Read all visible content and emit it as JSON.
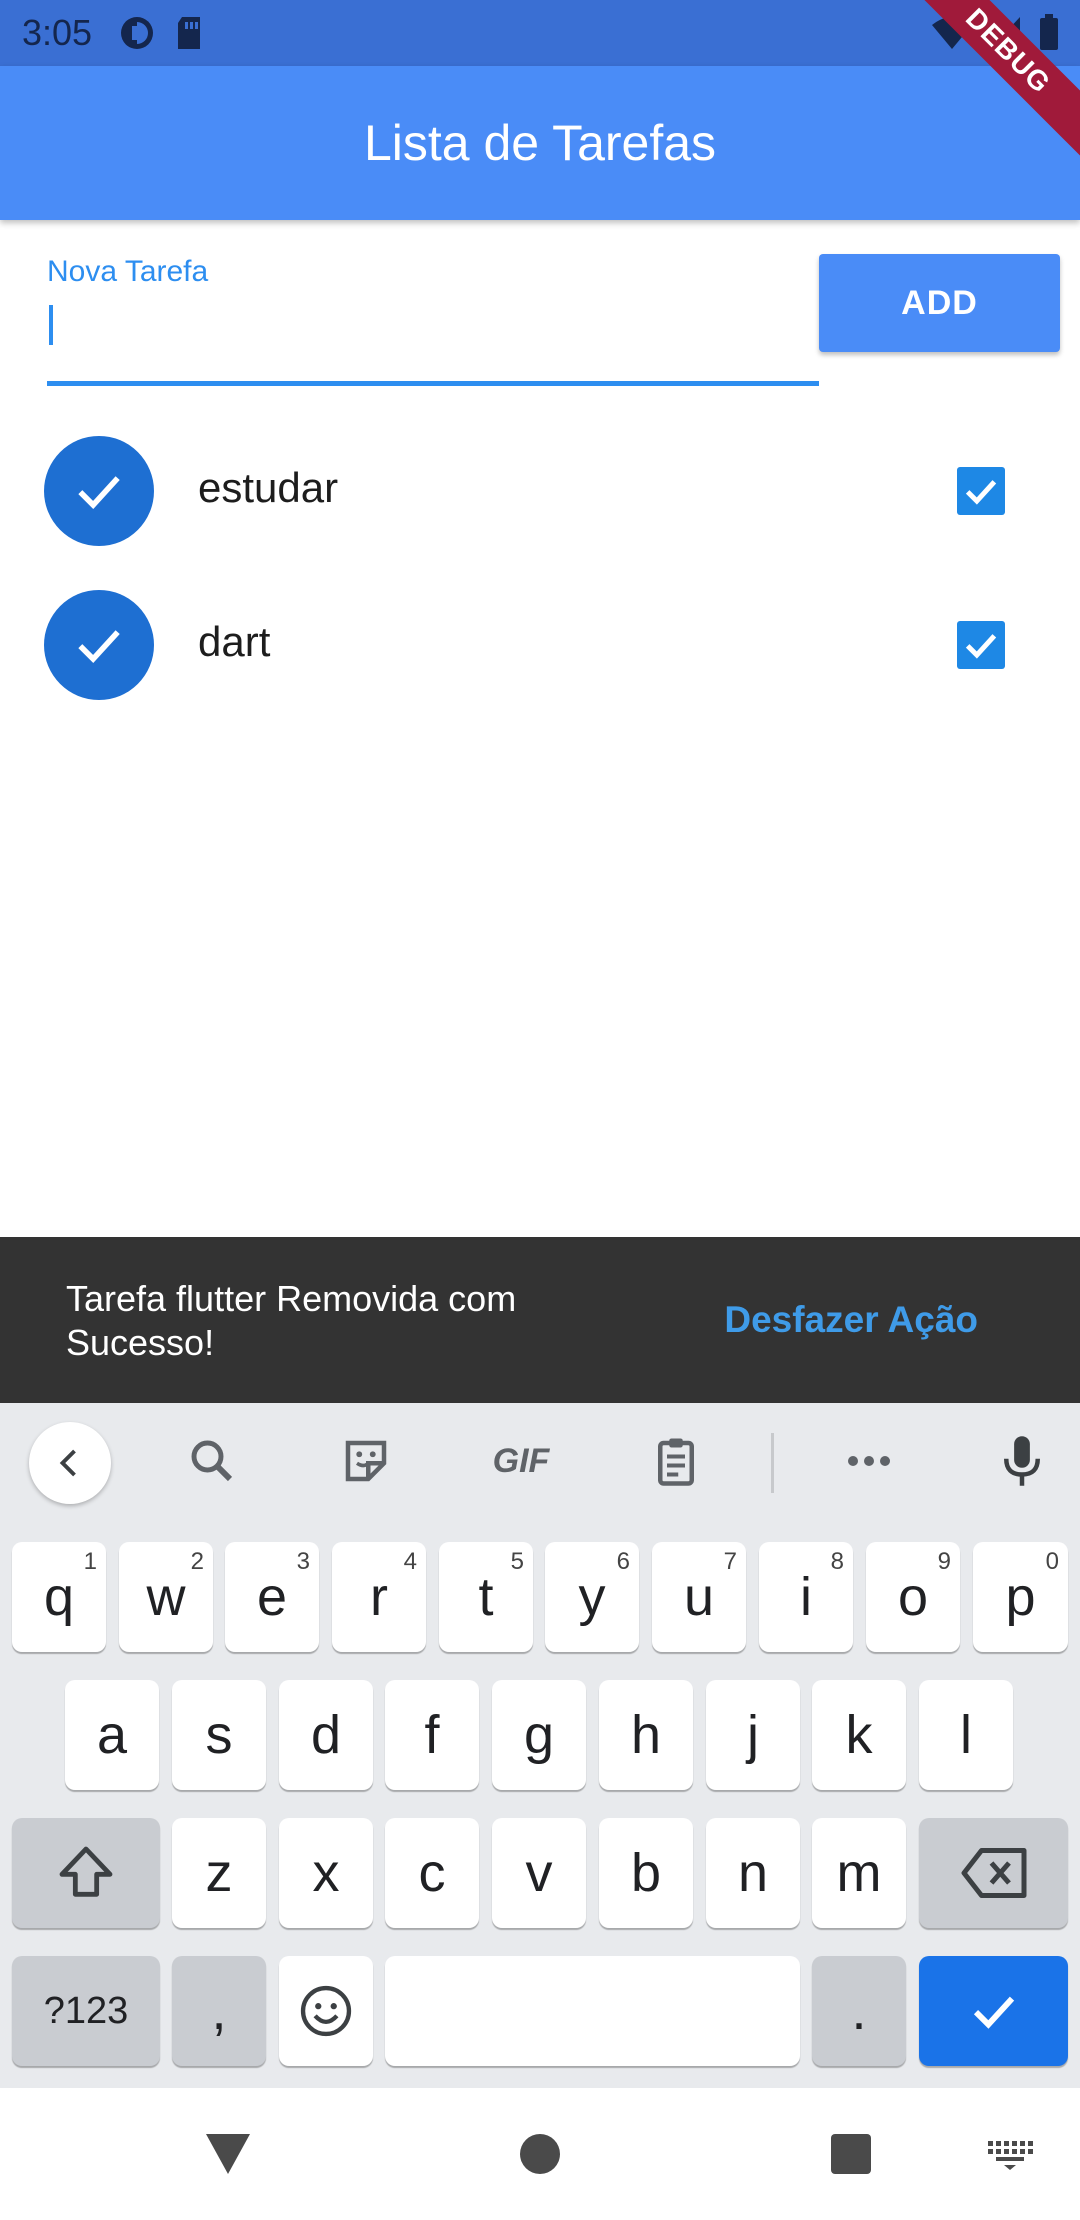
{
  "status_bar": {
    "time": "3:05",
    "icons_left": [
      "data-saver-icon",
      "sd-card-icon"
    ],
    "icons_right": [
      "wifi-icon",
      "signal-icon",
      "battery-icon"
    ]
  },
  "debug_banner": "DEBUG",
  "app_bar": {
    "title": "Lista de Tarefas"
  },
  "new_task": {
    "label": "Nova Tarefa",
    "value": "",
    "button_label": "ADD"
  },
  "tasks": [
    {
      "title": "estudar",
      "done": true
    },
    {
      "title": "dart",
      "done": true
    }
  ],
  "snackbar": {
    "message": "Tarefa flutter Removida com Sucesso!",
    "action": "Desfazer Ação"
  },
  "keyboard": {
    "toolbar": [
      "back-icon",
      "search-icon",
      "sticker-icon",
      "GIF",
      "clipboard-icon",
      "more-icon",
      "mic-icon"
    ],
    "row1": [
      {
        "k": "q",
        "h": "1"
      },
      {
        "k": "w",
        "h": "2"
      },
      {
        "k": "e",
        "h": "3"
      },
      {
        "k": "r",
        "h": "4"
      },
      {
        "k": "t",
        "h": "5"
      },
      {
        "k": "y",
        "h": "6"
      },
      {
        "k": "u",
        "h": "7"
      },
      {
        "k": "i",
        "h": "8"
      },
      {
        "k": "o",
        "h": "9"
      },
      {
        "k": "p",
        "h": "0"
      }
    ],
    "row2": [
      "a",
      "s",
      "d",
      "f",
      "g",
      "h",
      "j",
      "k",
      "l"
    ],
    "row3": [
      "z",
      "x",
      "c",
      "v",
      "b",
      "n",
      "m"
    ],
    "symbols_key": "?123",
    "comma_key": ",",
    "period_key": "."
  },
  "colors": {
    "primary": "#4a8cf7",
    "accent": "#2d8ef0",
    "snackbar_bg": "#333333",
    "snackbar_action": "#3f9be8",
    "checkbox": "#1e88e5",
    "avatar": "#1e6fd2"
  }
}
